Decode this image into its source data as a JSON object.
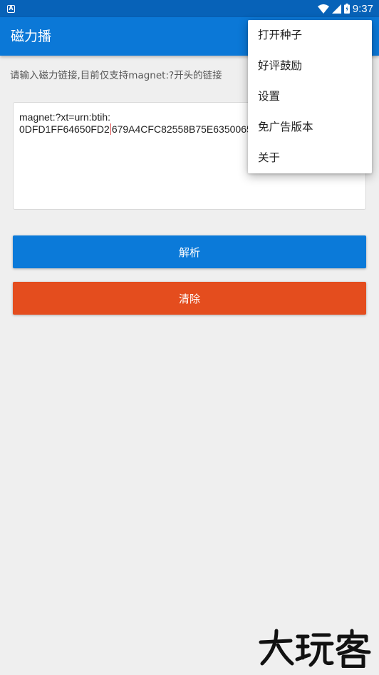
{
  "status_bar": {
    "notification_icon_letter": "A",
    "time": "9:37",
    "icons": [
      "wifi-icon",
      "cell-signal-icon",
      "battery-icon"
    ]
  },
  "app_bar": {
    "title": "磁力播"
  },
  "hint": "请输入磁力链接,目前仅支持magnet:?开头的链接",
  "magnet_input": {
    "line1": "magnet:?xt=urn:btih:",
    "line2_before_caret": "0DFD1FF64650FD2",
    "line2_after_caret": "679A4CFC82558B75E6350065"
  },
  "buttons": {
    "parse": "解析",
    "clear": "清除"
  },
  "menu": {
    "items": [
      "打开种子",
      "好评鼓励",
      "设置",
      "免广告版本",
      "关于"
    ]
  },
  "watermark": "大玩客",
  "colors": {
    "status_bar": "#0762b8",
    "app_bar": "#0b78d7",
    "parse_button": "#0b7ad9",
    "clear_button": "#e44d1e",
    "background": "#efefef"
  }
}
